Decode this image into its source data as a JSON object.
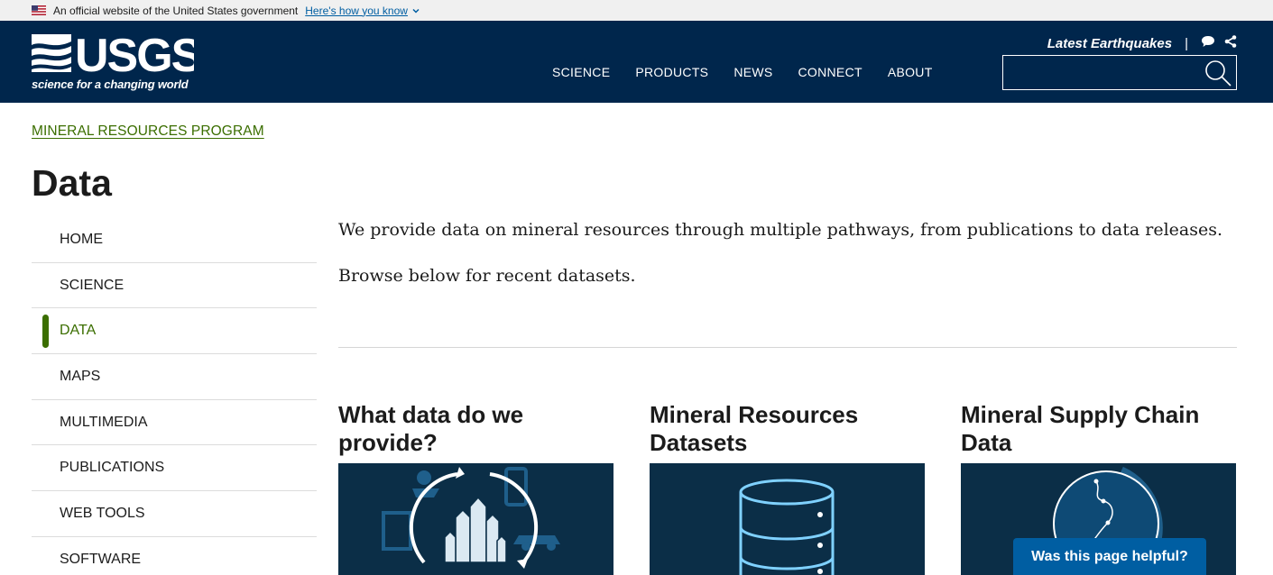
{
  "gov_banner": {
    "text": "An official website of the United States government",
    "link": "Here's how you know"
  },
  "header": {
    "logo_tagline": "science for a changing world",
    "quick_link": "Latest Earthquakes",
    "separator": "|",
    "search_placeholder": "",
    "nav": [
      "SCIENCE",
      "PRODUCTS",
      "NEWS",
      "CONNECT",
      "ABOUT"
    ]
  },
  "breadcrumb": "MINERAL RESOURCES PROGRAM",
  "page_title": "Data",
  "sidenav": {
    "items": [
      "HOME",
      "SCIENCE",
      "DATA",
      "MAPS",
      "MULTIMEDIA",
      "PUBLICATIONS",
      "WEB TOOLS",
      "SOFTWARE"
    ],
    "active": "DATA"
  },
  "intro": {
    "p1": "We provide data on mineral resources through multiple pathways, from publications to data releases.",
    "p2": "Browse below for recent datasets."
  },
  "cards": [
    {
      "title": "What data do we provide?"
    },
    {
      "title": "Mineral Resources Datasets"
    },
    {
      "title": "Mineral Supply Chain Data"
    }
  ],
  "feedback_label": "Was this page helpful?",
  "colors": {
    "header_bg": "#00264c",
    "accent_green": "#3b6e00",
    "link_blue": "#005ea2",
    "card_bg": "#0b2e47"
  },
  "icons": [
    "us-flag-icon",
    "chevron-down-icon",
    "comment-icon",
    "share-icon",
    "search-icon"
  ]
}
